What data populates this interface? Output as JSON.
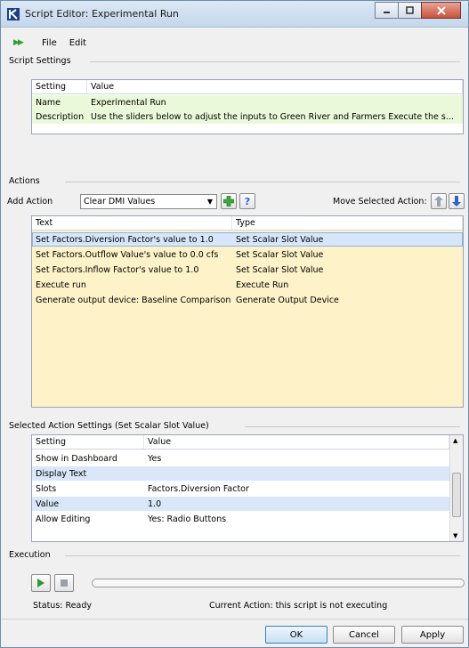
{
  "window": {
    "title": "Script Editor: Experimental Run"
  },
  "menu": {
    "file": "File",
    "edit": "Edit"
  },
  "script_settings": {
    "label": "Script Settings",
    "headers": [
      "Setting",
      "Value"
    ],
    "rows": [
      {
        "setting": "Name",
        "value": "Experimental Run"
      },
      {
        "setting": "Description",
        "value": "Use the sliders below to adjust the inputs to Green River and Farmers Execute the s..."
      }
    ]
  },
  "actions": {
    "label": "Actions",
    "add_action_label": "Add Action",
    "add_action_selected": "Clear DMI Values",
    "move_label": "Move Selected Action:",
    "headers": [
      "Text",
      "Type"
    ],
    "rows": [
      {
        "text": "Set Factors.Diversion Factor's value to 1.0",
        "type": "Set Scalar Slot Value",
        "style": "sel"
      },
      {
        "text": "Set Factors.Outflow Value's value to 0.0 cfs",
        "type": "Set Scalar Slot Value",
        "style": "yellow"
      },
      {
        "text": "Set Factors.Inflow Factor's value to 1.0",
        "type": "Set Scalar Slot Value",
        "style": "yellow"
      },
      {
        "text": "Execute run",
        "type": "Execute Run",
        "style": "yellow"
      },
      {
        "text": "Generate output device: Baseline Comparison",
        "type": "Generate Output Device",
        "style": "yellow"
      }
    ]
  },
  "selected_settings": {
    "label": "Selected Action Settings (Set Scalar Slot Value)",
    "headers": [
      "Setting",
      "Value"
    ],
    "rows": [
      {
        "setting": "Show in Dashboard",
        "value": "Yes"
      },
      {
        "setting": "Display Text",
        "value": ""
      },
      {
        "setting": "Slots",
        "value": "Factors.Diversion Factor"
      },
      {
        "setting": "Value",
        "value": "1.0"
      },
      {
        "setting": "Allow Editing",
        "value": "Yes: Radio Buttons"
      }
    ]
  },
  "execution": {
    "label": "Execution",
    "status": "Status: Ready",
    "current_action": "Current Action:  this script is not executing"
  },
  "buttons": {
    "ok": "OK",
    "cancel": "Cancel",
    "apply": "Apply"
  }
}
